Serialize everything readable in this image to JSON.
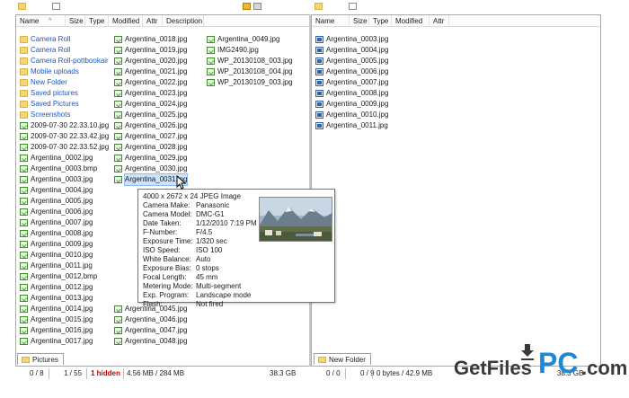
{
  "left_pane": {
    "columns": [
      "Name",
      "Size",
      "Type",
      "Modified",
      "Attr",
      "Description"
    ],
    "sort_indicator": "^",
    "col1": [
      {
        "name": "Camera Roll",
        "kind": "folder"
      },
      {
        "name": "Camera Roll",
        "kind": "folder"
      },
      {
        "name": "Camera Roll-pottbookair",
        "kind": "folder"
      },
      {
        "name": "Mobile uploads",
        "kind": "folder"
      },
      {
        "name": "New Folder",
        "kind": "folder"
      },
      {
        "name": "Saved pictures",
        "kind": "folder"
      },
      {
        "name": "Saved Pictures",
        "kind": "folder"
      },
      {
        "name": "Screenshots",
        "kind": "folder"
      },
      {
        "name": "2009-07-30 22.33.10.jpg",
        "kind": "img"
      },
      {
        "name": "2009-07-30 22.33.42.jpg",
        "kind": "img"
      },
      {
        "name": "2009-07-30 22.33.52.jpg",
        "kind": "img"
      },
      {
        "name": "Argentina_0002.jpg",
        "kind": "img"
      },
      {
        "name": "Argentina_0003.bmp",
        "kind": "img"
      },
      {
        "name": "Argentina_0003.jpg",
        "kind": "img"
      },
      {
        "name": "Argentina_0004.jpg",
        "kind": "img"
      },
      {
        "name": "Argentina_0005.jpg",
        "kind": "img"
      },
      {
        "name": "Argentina_0006.jpg",
        "kind": "img"
      },
      {
        "name": "Argentina_0007.jpg",
        "kind": "img"
      },
      {
        "name": "Argentina_0008.jpg",
        "kind": "img"
      },
      {
        "name": "Argentina_0009.jpg",
        "kind": "img"
      },
      {
        "name": "Argentina_0010.jpg",
        "kind": "img"
      },
      {
        "name": "Argentina_0011.jpg",
        "kind": "img"
      },
      {
        "name": "Argentina_0012.bmp",
        "kind": "img"
      },
      {
        "name": "Argentina_0012.jpg",
        "kind": "img"
      },
      {
        "name": "Argentina_0013.jpg",
        "kind": "img"
      },
      {
        "name": "Argentina_0014.jpg",
        "kind": "img"
      },
      {
        "name": "Argentina_0015.jpg",
        "kind": "img"
      },
      {
        "name": "Argentina_0016.jpg",
        "kind": "img"
      },
      {
        "name": "Argentina_0017.jpg",
        "kind": "img"
      }
    ],
    "col2": [
      {
        "name": "Argentina_0018.jpg",
        "kind": "img"
      },
      {
        "name": "Argentina_0019.jpg",
        "kind": "img"
      },
      {
        "name": "Argentina_0020.jpg",
        "kind": "img"
      },
      {
        "name": "Argentina_0021.jpg",
        "kind": "img"
      },
      {
        "name": "Argentina_0022.jpg",
        "kind": "img"
      },
      {
        "name": "Argentina_0023.jpg",
        "kind": "img"
      },
      {
        "name": "Argentina_0024.jpg",
        "kind": "img"
      },
      {
        "name": "Argentina_0025.jpg",
        "kind": "img"
      },
      {
        "name": "Argentina_0026.jpg",
        "kind": "img"
      },
      {
        "name": "Argentina_0027.jpg",
        "kind": "img"
      },
      {
        "name": "Argentina_0028.jpg",
        "kind": "img"
      },
      {
        "name": "Argentina_0029.jpg",
        "kind": "img"
      },
      {
        "name": "Argentina_0030.jpg",
        "kind": "img"
      },
      {
        "name": "Argentina_0031.jpg",
        "kind": "img",
        "selected": true
      }
    ],
    "col2_bottom": [
      {
        "name": "Argentina_0045.jpg",
        "kind": "img"
      },
      {
        "name": "Argentina_0046.jpg",
        "kind": "img"
      },
      {
        "name": "Argentina_0047.jpg",
        "kind": "img"
      },
      {
        "name": "Argentina_0048.jpg",
        "kind": "img"
      }
    ],
    "col3": [
      {
        "name": "Argentina_0049.jpg",
        "kind": "img"
      },
      {
        "name": "IMG2490.jpg",
        "kind": "img"
      },
      {
        "name": "WP_20130108_003.jpg",
        "kind": "img"
      },
      {
        "name": "WP_20130108_004.jpg",
        "kind": "img"
      },
      {
        "name": "WP_20130109_003.jpg",
        "kind": "img"
      }
    ],
    "tab": "Pictures",
    "status": {
      "folders": "0 / 8",
      "files": "1 / 55",
      "hidden": "1 hidden",
      "size": "4.56 MB / 284 MB",
      "free": "38.3 GB"
    }
  },
  "right_pane": {
    "columns": [
      "Name",
      "Size",
      "Type",
      "Modified",
      "Attr"
    ],
    "files": [
      {
        "name": "Argentina_0003.jpg",
        "kind": "jpgb"
      },
      {
        "name": "Argentina_0004.jpg",
        "kind": "jpgb"
      },
      {
        "name": "Argentina_0005.jpg",
        "kind": "jpgb"
      },
      {
        "name": "Argentina_0006.jpg",
        "kind": "jpgb"
      },
      {
        "name": "Argentina_0007.jpg",
        "kind": "jpgb"
      },
      {
        "name": "Argentina_0008.jpg",
        "kind": "jpgb"
      },
      {
        "name": "Argentina_0009.jpg",
        "kind": "jpgb"
      },
      {
        "name": "Argentina_0010.jpg",
        "kind": "jpgb"
      },
      {
        "name": "Argentina_0011.jpg",
        "kind": "jpgb"
      }
    ],
    "tab": "New Folder",
    "status": {
      "folders": "0 / 0",
      "files": "0 / 9",
      "size": "0 bytes / 42.9 MB",
      "free": "38.3 GB"
    }
  },
  "tooltip": {
    "header": "4000 x 2672 x 24 JPEG Image",
    "rows": [
      {
        "label": "Camera Make:",
        "value": "Panasonic"
      },
      {
        "label": "Camera Model:",
        "value": "DMC-G1"
      },
      {
        "label": "Date Taken:",
        "value": "1/12/2010 7:19 PM"
      },
      {
        "label": "F-Number:",
        "value": "F/4.5"
      },
      {
        "label": "Exposure Time:",
        "value": "1/320 sec"
      },
      {
        "label": "ISO Speed:",
        "value": "ISO 100"
      },
      {
        "label": "White Balance:",
        "value": "Auto"
      },
      {
        "label": "Exposure Bias:",
        "value": "0 stops"
      },
      {
        "label": "Focal Length:",
        "value": "45 mm"
      },
      {
        "label": "Metering Mode:",
        "value": "Multi-segment"
      },
      {
        "label": "Exp. Program:",
        "value": "Landscape mode"
      },
      {
        "label": "Flash:",
        "value": "Not fired"
      }
    ]
  },
  "watermark": {
    "part1": "GetFiles",
    "part2": "PC",
    "part3": ".com",
    "colors": {
      "dark": "#3a3a3a",
      "accent": "#1e88d6"
    }
  },
  "colors": {
    "folder_link": "#1a56c8",
    "hidden_text": "#cc0000",
    "selection": "#cde3fb"
  }
}
